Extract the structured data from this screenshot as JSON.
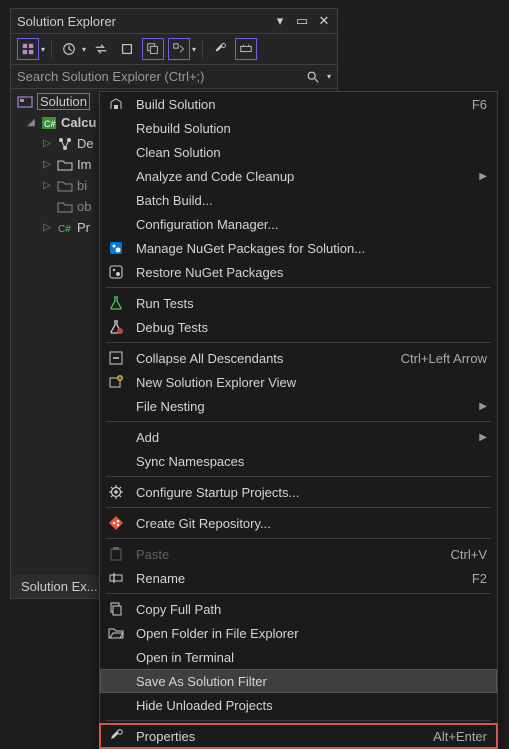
{
  "panel": {
    "title": "Solution Explorer",
    "footer_tab": "Solution Ex..."
  },
  "search": {
    "placeholder": "Search Solution Explorer (Ctrl+;)"
  },
  "tree": {
    "solution_label": "Solution",
    "project_label": "Calcu",
    "items": [
      {
        "label": "De"
      },
      {
        "label": "Im"
      },
      {
        "label": "bi"
      },
      {
        "label": "ob"
      },
      {
        "label": "Pr"
      }
    ]
  },
  "menu": [
    {
      "t": "item",
      "icon": "build",
      "label": "Build Solution",
      "shortcut": "F6"
    },
    {
      "t": "item",
      "icon": "",
      "label": "Rebuild Solution"
    },
    {
      "t": "item",
      "icon": "",
      "label": "Clean Solution"
    },
    {
      "t": "item",
      "icon": "",
      "label": "Analyze and Code Cleanup",
      "submenu": true
    },
    {
      "t": "item",
      "icon": "",
      "label": "Batch Build..."
    },
    {
      "t": "item",
      "icon": "",
      "label": "Configuration Manager..."
    },
    {
      "t": "item",
      "icon": "nuget",
      "label": "Manage NuGet Packages for Solution..."
    },
    {
      "t": "item",
      "icon": "nugetr",
      "label": "Restore NuGet Packages"
    },
    {
      "t": "sep"
    },
    {
      "t": "item",
      "icon": "flask",
      "label": "Run Tests"
    },
    {
      "t": "item",
      "icon": "flaskd",
      "label": "Debug Tests"
    },
    {
      "t": "sep"
    },
    {
      "t": "item",
      "icon": "collapse",
      "label": "Collapse All Descendants",
      "shortcut": "Ctrl+Left Arrow"
    },
    {
      "t": "item",
      "icon": "newview",
      "label": "New Solution Explorer View"
    },
    {
      "t": "item",
      "icon": "",
      "label": "File Nesting",
      "submenu": true
    },
    {
      "t": "sep"
    },
    {
      "t": "item",
      "icon": "",
      "label": "Add",
      "submenu": true
    },
    {
      "t": "item",
      "icon": "",
      "label": "Sync Namespaces"
    },
    {
      "t": "sep"
    },
    {
      "t": "item",
      "icon": "gear",
      "label": "Configure Startup Projects..."
    },
    {
      "t": "sep"
    },
    {
      "t": "item",
      "icon": "git",
      "label": "Create Git Repository..."
    },
    {
      "t": "sep"
    },
    {
      "t": "item",
      "icon": "paste",
      "label": "Paste",
      "shortcut": "Ctrl+V",
      "disabled": true
    },
    {
      "t": "item",
      "icon": "rename",
      "label": "Rename",
      "shortcut": "F2"
    },
    {
      "t": "sep"
    },
    {
      "t": "item",
      "icon": "copy",
      "label": "Copy Full Path"
    },
    {
      "t": "item",
      "icon": "folder",
      "label": "Open Folder in File Explorer"
    },
    {
      "t": "item",
      "icon": "",
      "label": "Open in Terminal"
    },
    {
      "t": "item",
      "icon": "",
      "label": "Save As Solution Filter",
      "hovered": true
    },
    {
      "t": "item",
      "icon": "",
      "label": "Hide Unloaded Projects"
    },
    {
      "t": "sep"
    },
    {
      "t": "item",
      "icon": "wrench",
      "label": "Properties",
      "shortcut": "Alt+Enter",
      "redoutline": true
    }
  ],
  "icons": {
    "dropdown": "▾",
    "arrow_right": "▶",
    "twister_collapsed": "▷",
    "twister_expanded": "◢"
  }
}
